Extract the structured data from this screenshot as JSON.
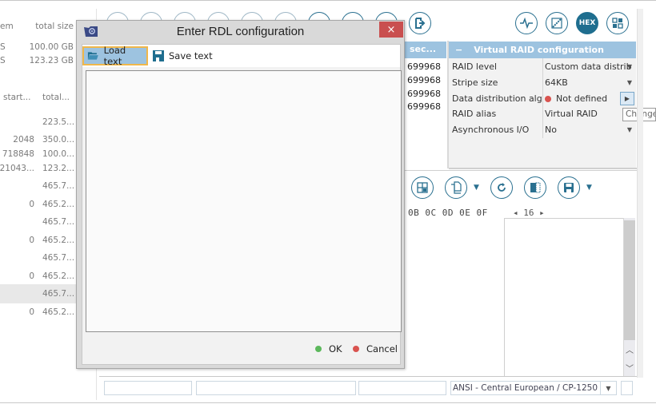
{
  "left_list": {
    "top_headers": {
      "col1": "em",
      "col2": "total size"
    },
    "top_rows": [
      {
        "col1": "S",
        "col2": "100.00 GB"
      },
      {
        "col1": "S",
        "col2": "123.23 GB"
      }
    ],
    "headers": {
      "start": "start...",
      "total": "total..."
    },
    "rows": [
      {
        "start": "",
        "total": "223.5..."
      },
      {
        "start": "2048",
        "total": "350.0..."
      },
      {
        "start": "718848",
        "total": "100.0..."
      },
      {
        "start": "21043...",
        "total": "123.2..."
      },
      {
        "start": "",
        "total": "465.7..."
      },
      {
        "start": "0",
        "total": "465.2..."
      },
      {
        "start": "",
        "total": "465.7..."
      },
      {
        "start": "0",
        "total": "465.2..."
      },
      {
        "start": "",
        "total": "465.7..."
      },
      {
        "start": "0",
        "total": "465.2..."
      },
      {
        "start": "",
        "total": "465.7..."
      },
      {
        "start": "0",
        "total": "465.2..."
      }
    ]
  },
  "toolbar": {
    "exit_icon": "exit-icon",
    "right_icons": [
      "waveform-icon",
      "chart-icon",
      "hex-icon",
      "grid-icon"
    ],
    "hex_label": "HEX"
  },
  "sectors": {
    "header": "sec...",
    "values": [
      "699968",
      "699968",
      "699968",
      "699968"
    ]
  },
  "raid_config": {
    "title": "Virtual RAID configuration",
    "collapse": "−",
    "rows": [
      {
        "key": "RAID level",
        "value": "Custom data distrib",
        "control": "dropdown"
      },
      {
        "key": "Stripe size",
        "value": "64KB",
        "control": "dropdown"
      },
      {
        "key": "Data distribution alg...",
        "value": "Not defined",
        "control": "change-button",
        "status": "error"
      },
      {
        "key": "RAID alias",
        "value": "Virtual RAID",
        "control": "text"
      },
      {
        "key": "Asynchronous I/O",
        "value": "No",
        "control": "dropdown"
      }
    ],
    "tooltip": "Change",
    "status_color": "#d9534f"
  },
  "hex_view": {
    "header": "0B 0C 0D 0E 0F",
    "columns": "16",
    "toolbar_icons": [
      "grid-view-icon",
      "copy-icon",
      "refresh-icon",
      "panel-icon",
      "save-icon"
    ]
  },
  "status_bar": {
    "encoding": "ANSI - Central European / CP-1250"
  },
  "dialog": {
    "title": "Enter RDL configuration",
    "close": "×",
    "load_text": "Load text",
    "save_text": "Save text",
    "text_value": "",
    "ok": "OK",
    "cancel": "Cancel",
    "ok_color": "#5cb85c",
    "cancel_color": "#d9534f",
    "accent": "#9dc3e0",
    "focus_border": "#f0b74a",
    "close_bg": "#c94f4f"
  }
}
